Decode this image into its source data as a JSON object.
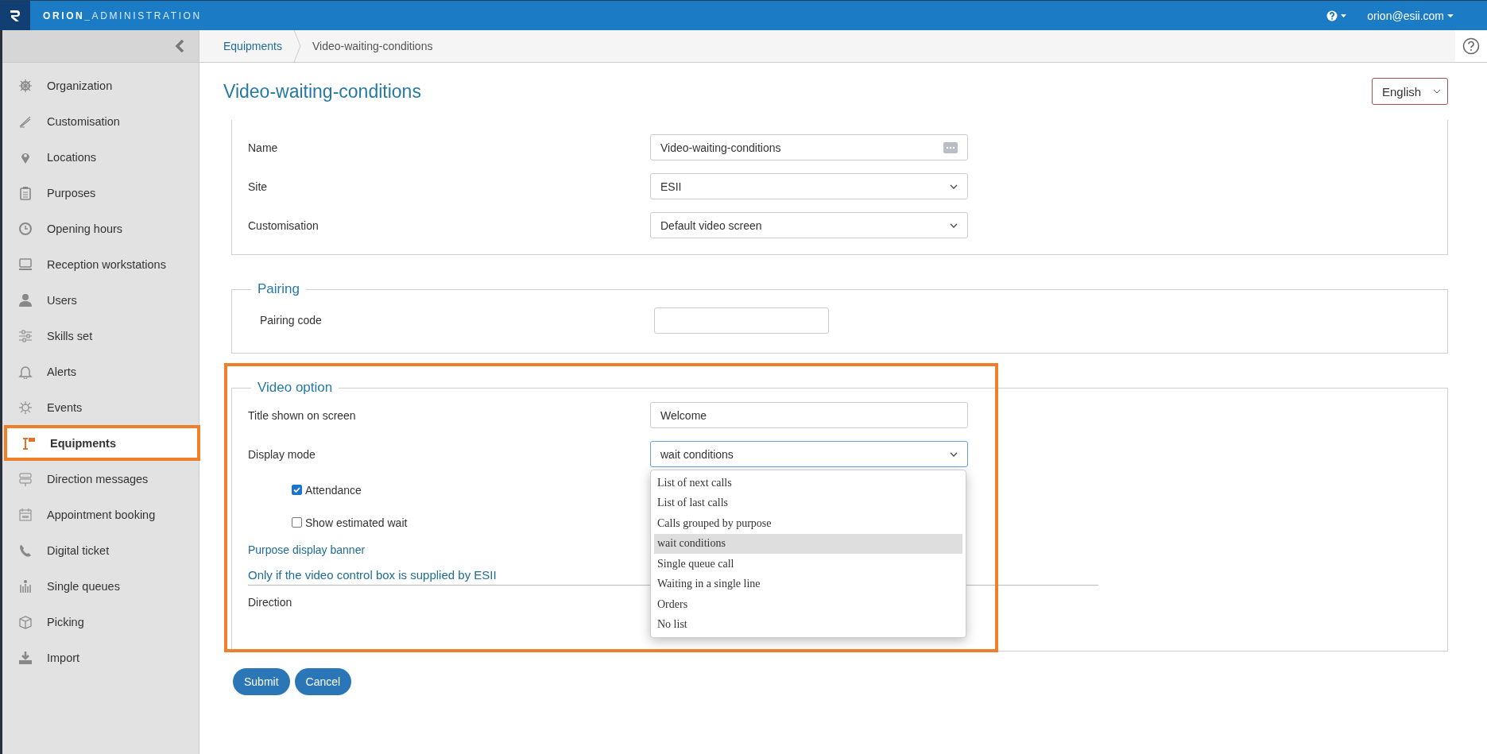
{
  "topbar": {
    "brand_bold": "ORION_",
    "brand_light": "ADMINISTRATION",
    "user": "orion@esii.com"
  },
  "sidebar": {
    "items": [
      {
        "label": "Organization",
        "selected": false
      },
      {
        "label": "Customisation",
        "selected": false
      },
      {
        "label": "Locations",
        "selected": false
      },
      {
        "label": "Purposes",
        "selected": false
      },
      {
        "label": "Opening hours",
        "selected": false
      },
      {
        "label": "Reception workstations",
        "selected": false
      },
      {
        "label": "Users",
        "selected": false
      },
      {
        "label": "Skills set",
        "selected": false
      },
      {
        "label": "Alerts",
        "selected": false
      },
      {
        "label": "Events",
        "selected": false
      },
      {
        "label": "Equipments",
        "selected": true
      },
      {
        "label": "Direction messages",
        "selected": false
      },
      {
        "label": "Appointment booking",
        "selected": false
      },
      {
        "label": "Digital ticket",
        "selected": false
      },
      {
        "label": "Single queues",
        "selected": false
      },
      {
        "label": "Picking",
        "selected": false
      },
      {
        "label": "Import",
        "selected": false
      }
    ]
  },
  "breadcrumb": [
    "Equipments",
    "Video-waiting-conditions"
  ],
  "page_title": "Video-waiting-conditions",
  "language": "English",
  "general": {
    "fields": [
      {
        "kind": "text",
        "label": "Name",
        "value": "Video-waiting-conditions"
      },
      {
        "kind": "select",
        "label": "Site",
        "value": "ESII"
      },
      {
        "kind": "select",
        "label": "Customisation",
        "value": "Default video screen"
      }
    ]
  },
  "pairing": {
    "legend": "Pairing",
    "label": "Pairing code"
  },
  "video_option": {
    "legend": "Video option",
    "title_label": "Title shown on screen",
    "title_value": "Welcome",
    "display_label": "Display mode",
    "display_value": "wait conditions",
    "expanded": true,
    "options": [
      {
        "label": "List of next calls",
        "selected": false
      },
      {
        "label": "List of last calls",
        "selected": false
      },
      {
        "label": "Calls grouped by purpose",
        "selected": false
      },
      {
        "label": "wait conditions",
        "selected": true
      },
      {
        "label": "Single queue call",
        "selected": false
      },
      {
        "label": "Waiting in a single line",
        "selected": false
      },
      {
        "label": "Orders",
        "selected": false
      },
      {
        "label": "No list",
        "selected": false
      }
    ],
    "checkboxes": [
      {
        "label": "Attendance",
        "checked": true
      },
      {
        "label": "Show estimated wait",
        "checked": false
      }
    ],
    "banner_link": "Purpose display banner",
    "section_title": "Only if the video control box is supplied by ESII",
    "direction_label": "Direction"
  },
  "buttons": [
    "Submit",
    "Cancel"
  ]
}
